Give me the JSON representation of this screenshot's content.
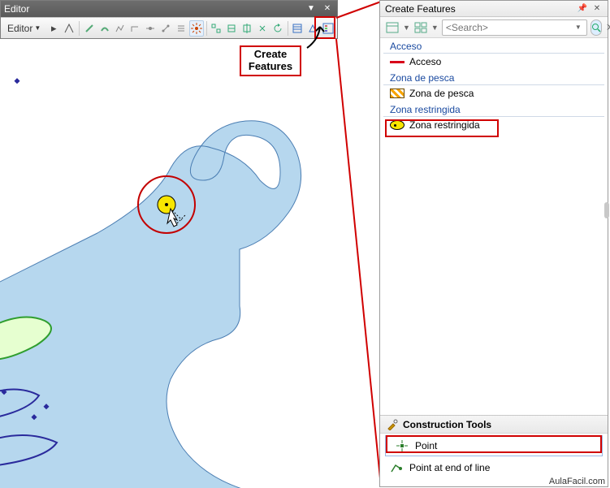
{
  "editor": {
    "title": "Editor",
    "menu_label": "Editor",
    "tools": [
      {
        "name": "edit-tool",
        "glyph": "▸"
      },
      {
        "name": "edit-annotation",
        "glyph": "◣"
      },
      {
        "name": "straight-segment",
        "glyph": "╱"
      },
      {
        "name": "arc-segment",
        "glyph": "◡"
      },
      {
        "name": "trace",
        "glyph": "⟋"
      },
      {
        "name": "right-angle",
        "glyph": "◿"
      },
      {
        "name": "midpoint",
        "glyph": "⊶"
      },
      {
        "name": "endpoint",
        "glyph": "⋰"
      },
      {
        "name": "distance-distance",
        "glyph": "≡"
      },
      {
        "name": "point-tool",
        "glyph": "✶",
        "active": true
      },
      {
        "name": "edit-vertices",
        "glyph": "◫"
      },
      {
        "name": "reshape",
        "glyph": "↯"
      },
      {
        "name": "cut-polygons",
        "glyph": "⊡"
      },
      {
        "name": "split-tool",
        "glyph": "✂"
      },
      {
        "name": "rotate-tool",
        "glyph": "⟳"
      },
      {
        "name": "attributes",
        "glyph": "▤"
      },
      {
        "name": "sketch-props",
        "glyph": "◳"
      },
      {
        "name": "create-features-btn",
        "glyph": "▥"
      }
    ],
    "callout": "Create Features"
  },
  "create_features": {
    "title": "Create Features",
    "search_placeholder": "<Search>",
    "groups": [
      {
        "header": "Acceso",
        "items": [
          {
            "label": "Acceso",
            "swatch": "line"
          }
        ]
      },
      {
        "header": "Zona de pesca",
        "items": [
          {
            "label": "Zona de pesca",
            "swatch": "hatch"
          }
        ]
      },
      {
        "header": "Zona restringida",
        "items": [
          {
            "label": "Zona restringida",
            "swatch": "point",
            "highlighted": true
          }
        ]
      }
    ],
    "construction_tools": {
      "title": "Construction Tools",
      "items": [
        {
          "label": "Point",
          "icon": "point",
          "selected": true
        },
        {
          "label": "Point at end of line",
          "icon": "line-end"
        }
      ]
    }
  },
  "watermark": "AulaFacil.com",
  "chart_data": null
}
